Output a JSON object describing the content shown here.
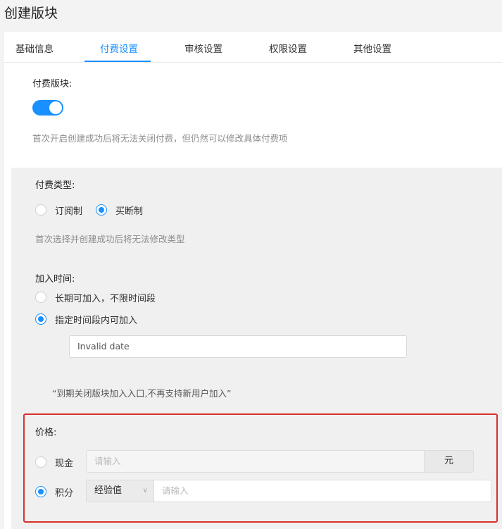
{
  "page": {
    "title": "创建版块"
  },
  "tabs": [
    {
      "label": "基础信息"
    },
    {
      "label": "付费设置",
      "active": true
    },
    {
      "label": "审核设置"
    },
    {
      "label": "权限设置"
    },
    {
      "label": "其他设置"
    }
  ],
  "paid": {
    "label": "付费版块:",
    "switch_on": true,
    "hint": "首次开启创建成功后将无法关闭付费，但仍然可以修改具体付费项"
  },
  "pay_type": {
    "label": "付费类型:",
    "options": [
      {
        "label": "订阅制",
        "checked": false
      },
      {
        "label": "买断制",
        "checked": true
      }
    ],
    "hint": "首次选择并创建成功后将无法修改类型"
  },
  "join_time": {
    "label": "加入时间:",
    "options": [
      {
        "label": "长期可加入，不限时间段",
        "checked": false
      },
      {
        "label": "指定时间段内可加入",
        "checked": true
      }
    ],
    "date_value": "Invalid date",
    "note": "“到期关闭版块加入入口,不再支持新用户加入”"
  },
  "price": {
    "label": "价格:",
    "cash": {
      "label": "现金",
      "checked": false,
      "placeholder": "请输入",
      "unit": "元"
    },
    "points": {
      "label": "积分",
      "checked": true,
      "select_value": "经验值",
      "placeholder": "请输入"
    }
  },
  "colors": {
    "accent": "#1890ff",
    "highlight_border": "#d9312a",
    "panel_bg": "#f0f0f0"
  },
  "icons": {
    "select_chevron": "chevron-down-icon"
  }
}
